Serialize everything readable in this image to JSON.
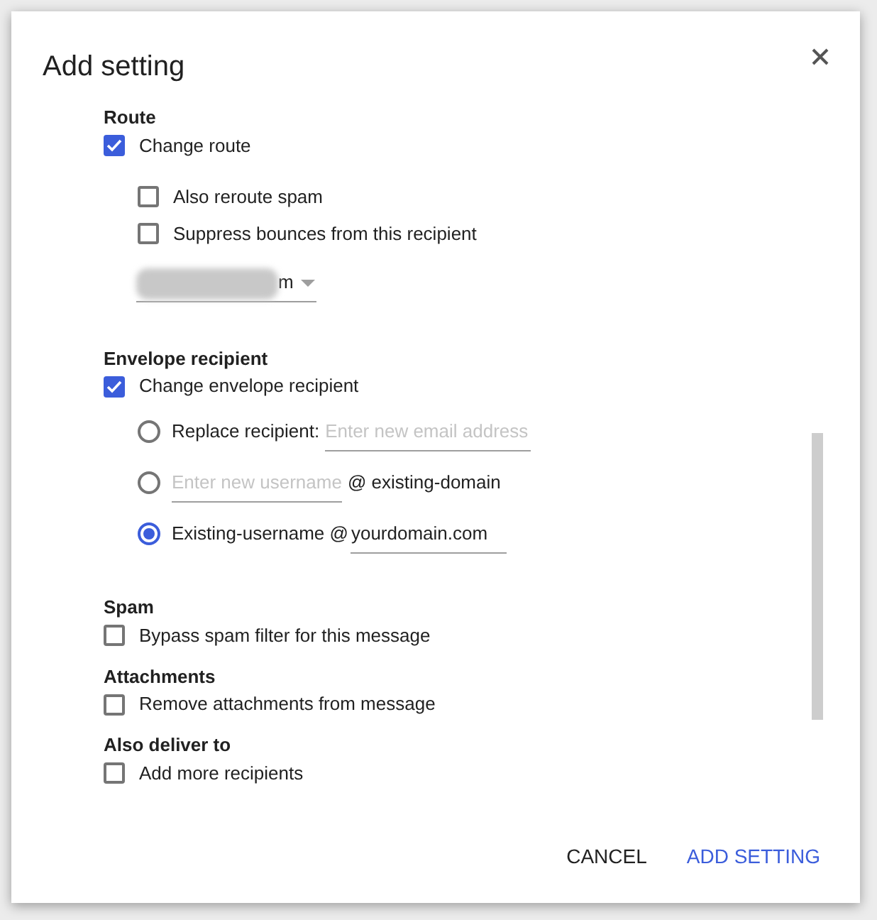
{
  "dialog": {
    "title": "Add setting"
  },
  "route": {
    "heading": "Route",
    "change": {
      "label": "Change route",
      "checked": true
    },
    "options": [
      {
        "label": "Also reroute spam",
        "checked": false
      },
      {
        "label": "Suppress bounces from this recipient",
        "checked": false
      }
    ],
    "dropdown": {
      "value": "m"
    }
  },
  "envelope": {
    "heading": "Envelope recipient",
    "change": {
      "label": "Change envelope recipient",
      "checked": true
    },
    "options": [
      {
        "kind": "replace",
        "label": "Replace recipient:",
        "placeholder": "Enter new email address",
        "selected": false
      },
      {
        "kind": "username",
        "placeholder": "Enter new username",
        "suffix": "@ existing-domain",
        "selected": false
      },
      {
        "kind": "existing",
        "label": "Existing-username @",
        "value": "yourdomain.com",
        "selected": true
      }
    ]
  },
  "sections": [
    {
      "heading": "Spam",
      "label": "Bypass spam filter for this message",
      "checked": false
    },
    {
      "heading": "Attachments",
      "label": "Remove attachments from message",
      "checked": false
    },
    {
      "heading": "Also deliver to",
      "label": "Add more recipients",
      "checked": false
    }
  ],
  "buttons": [
    {
      "label": "CANCEL",
      "kind": "secondary"
    },
    {
      "label": "ADD SETTING",
      "kind": "primary"
    }
  ]
}
